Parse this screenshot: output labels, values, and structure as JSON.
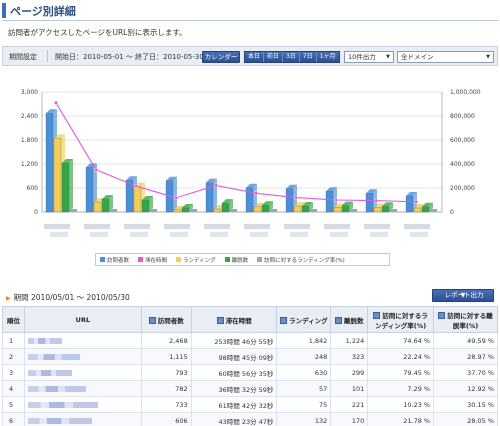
{
  "page": {
    "title": "ページ別詳細",
    "description": "訪問者がアクセスしたページをURL別に表示します。"
  },
  "filter": {
    "label": "期間設定",
    "range_text": "開始日：2010-05-01 〜 終了日：2010-05-30",
    "calendar_button": "カレンダー",
    "period_buttons": [
      "本日",
      "前日",
      "3日",
      "7日",
      "1ヶ月"
    ],
    "count_select": "10件出力",
    "domain_select": "全ドメイン"
  },
  "colors": {
    "visitors": "#4a90d9",
    "time": "#e05ad4",
    "landing": "#f1cf5a",
    "exits": "#35a647",
    "landing_rate": "#9aa7c2"
  },
  "chart_data": {
    "type": "bar",
    "y_left": {
      "ticks": [
        "3,000",
        "2,400",
        "1,800",
        "1,200",
        "600",
        "0"
      ],
      "ylim": [
        0,
        3000
      ]
    },
    "y_right": {
      "ticks": [
        "1,000,000",
        "800,000",
        "600,000",
        "400,000",
        "200,000",
        "0"
      ],
      "ylim": [
        0,
        1000000
      ]
    },
    "categories_count": 10,
    "series": [
      {
        "name": "訪問者数",
        "values": [
          2468,
          1115,
          793,
          782,
          733,
          606,
          580,
          520,
          470,
          400
        ]
      },
      {
        "name": "滞在時間",
        "values": [
          910000,
          352000,
          216000,
          118000,
          221000,
          156000,
          120000,
          100000,
          95000,
          85000
        ]
      },
      {
        "name": "ランディング",
        "values": [
          1842,
          248,
          630,
          57,
          75,
          132,
          150,
          120,
          110,
          100
        ]
      },
      {
        "name": "離脱数",
        "values": [
          1224,
          323,
          299,
          101,
          221,
          170,
          150,
          160,
          140,
          130
        ]
      },
      {
        "name": "訪問に対するランディング率(%)",
        "values": [
          74.64,
          22.24,
          79.45,
          7.29,
          10.23,
          21.78,
          25,
          23,
          23,
          25
        ]
      }
    ],
    "legend_position": "bottom"
  },
  "report": {
    "period_text": "期間 2010/05/01 〜 2010/05/30",
    "output_button": "レポート出力"
  },
  "table": {
    "headers": [
      "順位",
      "URL",
      "訪問者数",
      "滞在時間",
      "ランディング",
      "離脱数",
      "訪問に対するランディング率(%)",
      "訪問に対する離脱率(%)"
    ],
    "rows": [
      {
        "rank": "1",
        "visitors": "2,468",
        "time": "253時間 46分 55秒",
        "landing": "1,842",
        "exits": "1,224",
        "landing_rate": "74.64 %",
        "exit_rate": "49.59 %"
      },
      {
        "rank": "2",
        "visitors": "1,115",
        "time": "98時間 45分 09秒",
        "landing": "248",
        "exits": "323",
        "landing_rate": "22.24 %",
        "exit_rate": "28.97 %"
      },
      {
        "rank": "3",
        "visitors": "793",
        "time": "60時間 56分 35秒",
        "landing": "630",
        "exits": "299",
        "landing_rate": "79.45 %",
        "exit_rate": "37.70 %"
      },
      {
        "rank": "4",
        "visitors": "782",
        "time": "36時間 32分 59秒",
        "landing": "57",
        "exits": "101",
        "landing_rate": "7.29 %",
        "exit_rate": "12.92 %"
      },
      {
        "rank": "5",
        "visitors": "733",
        "time": "61時間 42分 32秒",
        "landing": "75",
        "exits": "221",
        "landing_rate": "10.23 %",
        "exit_rate": "30.15 %"
      },
      {
        "rank": "6",
        "visitors": "606",
        "time": "43時間 23分 47秒",
        "landing": "132",
        "exits": "170",
        "landing_rate": "21.78 %",
        "exit_rate": "28.05 %"
      }
    ]
  }
}
